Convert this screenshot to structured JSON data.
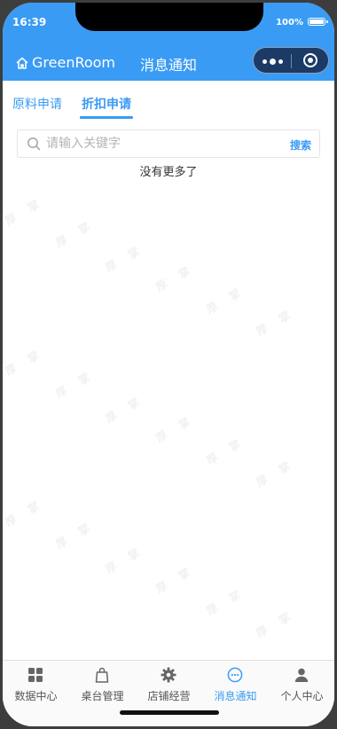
{
  "status_bar": {
    "time": "16:39",
    "battery": "100%"
  },
  "header": {
    "brand": "GreenRoom",
    "title": "消息通知"
  },
  "tabs": [
    {
      "label": "原料申请",
      "active": false
    },
    {
      "label": "折扣申请",
      "active": true
    }
  ],
  "search": {
    "placeholder": "请输入关键字",
    "value": "",
    "button_label": "搜索"
  },
  "list": {
    "empty_text": "没有更多了"
  },
  "watermark": {
    "text": "厚 掌"
  },
  "bottom_nav": [
    {
      "label": "数据中心",
      "icon": "grid-icon",
      "active": false
    },
    {
      "label": "桌台管理",
      "icon": "bag-icon",
      "active": false
    },
    {
      "label": "店铺经营",
      "icon": "gear-icon",
      "active": false
    },
    {
      "label": "消息通知",
      "icon": "message-icon",
      "active": true
    },
    {
      "label": "个人中心",
      "icon": "person-icon",
      "active": false
    }
  ],
  "colors": {
    "primary": "#3a9bf5",
    "capsule": "#1b3a66"
  }
}
